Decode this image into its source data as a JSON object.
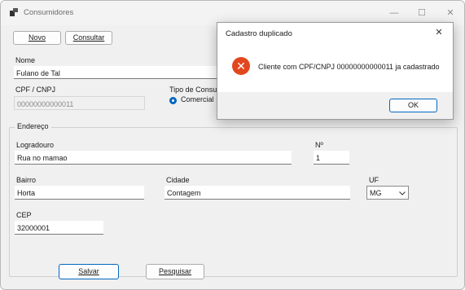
{
  "window": {
    "title": "Consumidores",
    "minimize_glyph": "—",
    "maximize_glyph": "☐",
    "close_glyph": "✕"
  },
  "toolbar": {
    "novo_label": "Novo",
    "consultar_label": "Consultar"
  },
  "form": {
    "nome_label": "Nome",
    "nome_value": "Fulano de Tal",
    "cpf_label": "CPF / CNPJ",
    "cpf_value": "00000000000011",
    "tipo_label": "Tipo de Consu",
    "tipo_option_label": "Comercial",
    "endereco_label": "Endereço",
    "logradouro_label": "Logradouro",
    "logradouro_value": "Rua no mamao",
    "numero_label": "Nº",
    "numero_value": "1",
    "bairro_label": "Bairro",
    "bairro_value": "Horta",
    "cidade_label": "Cidade",
    "cidade_value": "Contagem",
    "uf_label": "UF",
    "uf_value": "MG",
    "cep_label": "CEP",
    "cep_value": "32000001"
  },
  "actions": {
    "salvar_label": "Salvar",
    "pesquisar_label": "Pesquisar"
  },
  "dialog": {
    "title": "Cadastro duplicado",
    "close_glyph": "✕",
    "icon_glyph": "✕",
    "message": "Cliente com CPF/CNPJ 00000000000011 ja cadastrado",
    "ok_label": "OK"
  },
  "colors": {
    "accent": "#0067c0",
    "error": "#e2481f",
    "window_bg": "#f0f0f0"
  }
}
